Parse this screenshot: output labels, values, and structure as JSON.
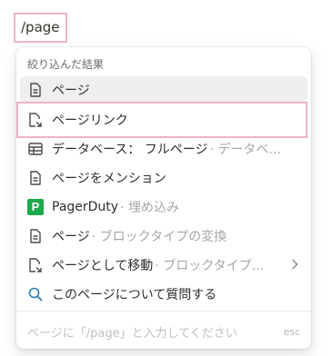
{
  "command_input": {
    "value": "/page"
  },
  "menu": {
    "section_title": "絞り込んだ結果",
    "items": [
      {
        "label": "ページ",
        "sub": "",
        "icon": "page-icon"
      },
      {
        "label": "ページリンク",
        "sub": "",
        "icon": "page-link-icon"
      },
      {
        "label": "データベース： フルページ",
        "sub": "データベ...",
        "icon": "table-icon"
      },
      {
        "label": "ページをメンション",
        "sub": "",
        "icon": "page-icon"
      },
      {
        "label": "PagerDuty",
        "sub": "埋め込み",
        "icon": "pagerduty-logo-icon"
      },
      {
        "label": "ページ",
        "sub": "ブロックタイプの変換",
        "icon": "page-icon"
      },
      {
        "label": "ページとして移動",
        "sub": "ブロックタイプ...",
        "icon": "page-link-icon"
      },
      {
        "label": "このページについて質問する",
        "sub": "",
        "icon": "search-icon"
      }
    ],
    "footer_hint": "ページに「/page」と入力してください",
    "footer_esc": "esc"
  },
  "pagerduty_logo_letter": "P",
  "highlight_color": "#efb3c8",
  "active_background": "#efefef"
}
